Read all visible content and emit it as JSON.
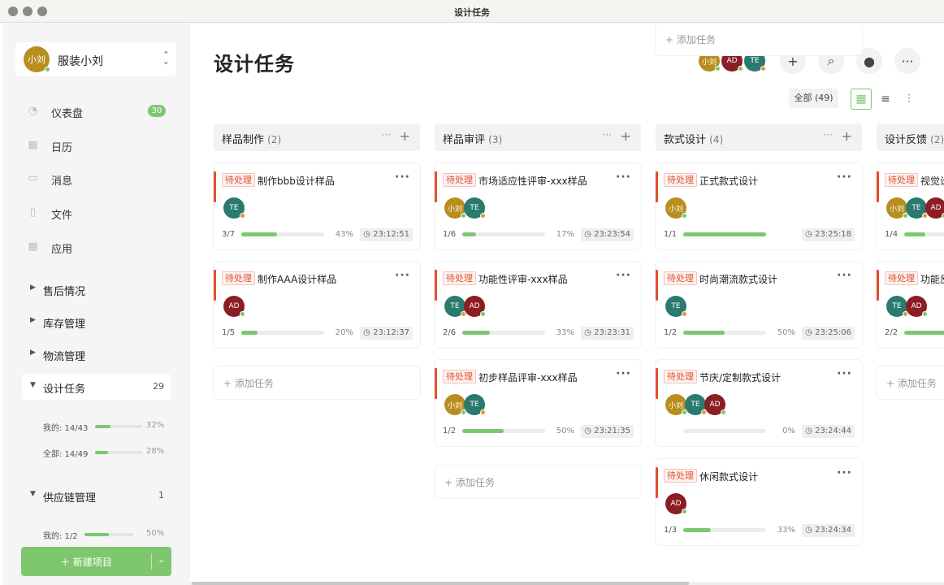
{
  "window": {
    "title": "设计任务"
  },
  "colors": {
    "accent_green": "#7bc96f",
    "accent_red": "#e0512e",
    "gold": "#b88e1f",
    "crimson": "#8c1d22",
    "teal": "#2a7a6f"
  },
  "workspace": {
    "avatar": "小刘",
    "name": "服装小刘",
    "switch_icon": "chevron-updown-icon"
  },
  "nav": [
    {
      "label": "仪表盘",
      "icon": "dashboard-icon",
      "glyph": "◔",
      "badge": "30"
    },
    {
      "label": "日历",
      "icon": "calendar-icon",
      "glyph": "▦"
    },
    {
      "label": "消息",
      "icon": "message-icon",
      "glyph": "▭"
    },
    {
      "label": "文件",
      "icon": "file-icon",
      "glyph": "▯"
    },
    {
      "label": "应用",
      "icon": "apps-icon",
      "glyph": "▦"
    }
  ],
  "groups": {
    "aftersales": {
      "label": "售后情况"
    },
    "inventory": {
      "label": "库存管理"
    },
    "logistics": {
      "label": "物流管理"
    },
    "design": {
      "label": "设计任务",
      "count": "29",
      "mine": {
        "label": "我的: 14/43",
        "pct": "32%",
        "value": 0.32
      },
      "all": {
        "label": "全部: 14/49",
        "pct": "28%",
        "value": 0.28
      }
    },
    "supply": {
      "label": "供应链管理",
      "count": "1",
      "mine": {
        "label": "我的: 1/2",
        "pct": "50%",
        "value": 0.5
      }
    }
  },
  "new_project": {
    "label": "＋ 新建项目"
  },
  "header": {
    "title": "设计任务",
    "members": [
      "小刘",
      "AD",
      "TE"
    ],
    "add": "+",
    "search": "⌕",
    "chat": "●",
    "more": "···",
    "filter_all": "全部 (49)"
  },
  "columns": [
    {
      "title": "样品制作",
      "count": "(2)",
      "cards": [
        {
          "tag": "待处理",
          "title": "制作bbb设计样品",
          "members": [
            "TE"
          ],
          "progress": "3/7",
          "value": 0.43,
          "pct": "43%",
          "time": "◷ 23:12:51"
        },
        {
          "tag": "待处理",
          "title": "制作AAA设计样品",
          "members": [
            "AD"
          ],
          "progress": "1/5",
          "value": 0.2,
          "pct": "20%",
          "time": "◷ 23:12:37"
        }
      ],
      "add_label": "+ 添加任务"
    },
    {
      "title": "样品审评",
      "count": "(3)",
      "cards": [
        {
          "tag": "待处理",
          "title": "市场适应性评审-xxx样品",
          "members": [
            "小刘",
            "TE"
          ],
          "progress": "1/6",
          "value": 0.17,
          "pct": "17%",
          "time": "◷ 23:23:54"
        },
        {
          "tag": "待处理",
          "title": "功能性评审-xxx样品",
          "members": [
            "TE",
            "AD"
          ],
          "progress": "2/6",
          "value": 0.33,
          "pct": "33%",
          "time": "◷ 23:23:31"
        },
        {
          "tag": "待处理",
          "title": "初步样品评审-xxx样品",
          "members": [
            "小刘",
            "TE"
          ],
          "progress": "1/2",
          "value": 0.5,
          "pct": "50%",
          "time": "◷ 23:21:35"
        }
      ],
      "add_label": "+ 添加任务"
    },
    {
      "title": "款式设计",
      "count": "(4)",
      "cards": [
        {
          "tag": "待处理",
          "title": "正式款式设计",
          "members": [
            "小刘"
          ],
          "progress": "1/1",
          "value": 1.0,
          "pct": "",
          "time": "◷ 23:25:18"
        },
        {
          "tag": "待处理",
          "title": "时尚潮流款式设计",
          "members": [
            "TE"
          ],
          "progress": "1/2",
          "value": 0.5,
          "pct": "50%",
          "time": "◷ 23:25:06"
        },
        {
          "tag": "待处理",
          "title": "节庆/定制款式设计",
          "members": [
            "小刘",
            "TE",
            "AD"
          ],
          "progress": "",
          "value": 0.0,
          "pct": "0%",
          "time": "◷ 23:24:44"
        },
        {
          "tag": "待处理",
          "title": "休闲款式设计",
          "members": [
            "AD"
          ],
          "progress": "1/3",
          "value": 0.33,
          "pct": "33%",
          "time": "◷ 23:24:34"
        }
      ],
      "add_label": "+ 添加任务"
    },
    {
      "title": "设计反馈",
      "count": "(2)",
      "cards": [
        {
          "tag": "待处理",
          "title": "视觉设计反馈",
          "members": [
            "小刘",
            "TE",
            "AD"
          ],
          "progress": "1/4",
          "value": 0.25,
          "pct": "",
          "time": ""
        },
        {
          "tag": "待处理",
          "title": "功能反馈",
          "members": [
            "TE",
            "AD"
          ],
          "progress": "2/2",
          "value": 1.0,
          "pct": "",
          "time": ""
        }
      ],
      "add_label": "+ 添加任务"
    }
  ]
}
